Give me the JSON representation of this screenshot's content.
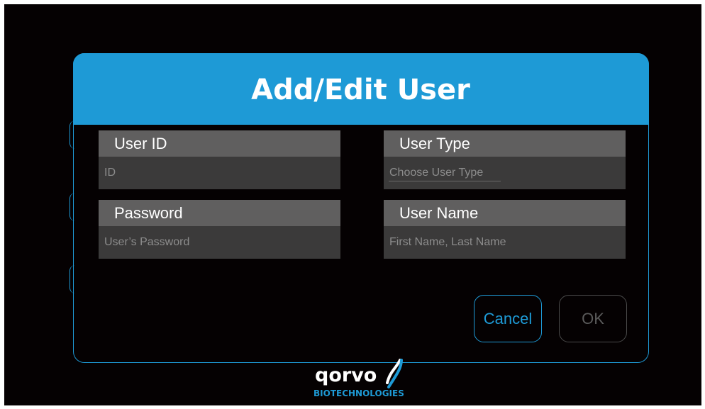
{
  "dialog": {
    "title": "Add/Edit User"
  },
  "fields": {
    "user_id": {
      "label": "User ID",
      "placeholder": "ID"
    },
    "user_type": {
      "label": "User Type",
      "placeholder": "Choose User Type"
    },
    "password": {
      "label": "Password",
      "placeholder": "User’s Password"
    },
    "user_name": {
      "label": "User Name",
      "placeholder": "First Name, Last Name"
    }
  },
  "buttons": {
    "cancel_label": "Cancel",
    "ok_label": "OK"
  },
  "logo": {
    "wordmark": "qorvo",
    "subtitle": "BIOTECHNOLOGIES"
  },
  "colors": {
    "accent": "#1e9ad6",
    "background": "#050102",
    "field_label_bg": "#605f5f",
    "field_input_bg": "#3b3a3a",
    "disabled": "#5a5a5a"
  }
}
